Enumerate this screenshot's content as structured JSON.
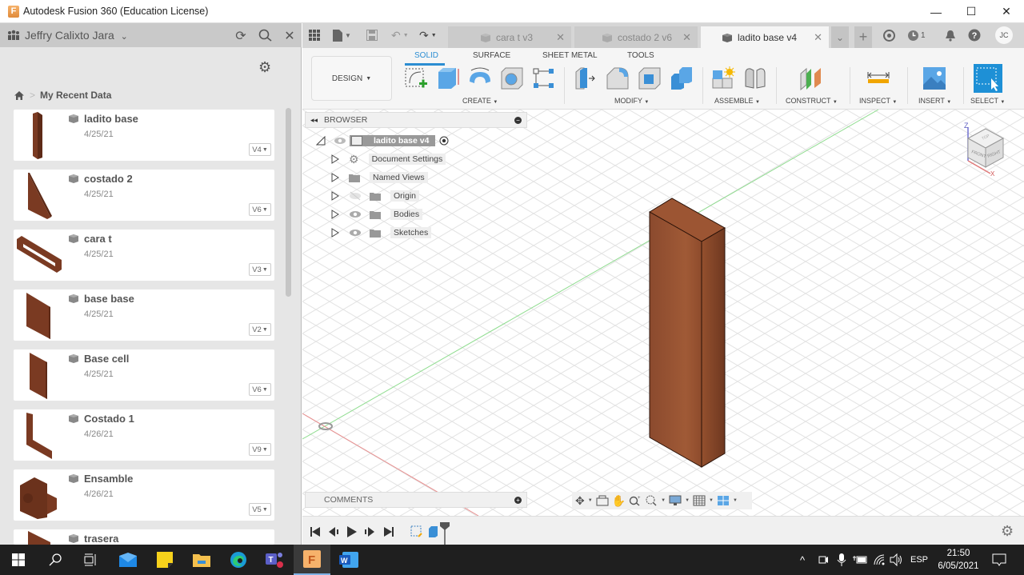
{
  "window": {
    "title": "Autodesk Fusion 360 (Education License)",
    "app_logo_letter": "F",
    "minimize": "—",
    "maximize": "☐",
    "close": "✕"
  },
  "data_panel": {
    "user_name": "Jeffry Calixto Jara",
    "breadcrumb": {
      "home_icon": "home-icon",
      "separator": ">",
      "current": "My Recent Data"
    },
    "items": [
      {
        "name": "ladito base",
        "date": "4/25/21",
        "version": "V4"
      },
      {
        "name": "costado 2",
        "date": "4/25/21",
        "version": "V6"
      },
      {
        "name": "cara t",
        "date": "4/25/21",
        "version": "V3"
      },
      {
        "name": "base base",
        "date": "4/25/21",
        "version": "V2"
      },
      {
        "name": "Base cell",
        "date": "4/25/21",
        "version": "V6"
      },
      {
        "name": "Costado 1",
        "date": "4/26/21",
        "version": "V9"
      },
      {
        "name": "Ensamble",
        "date": "4/26/21",
        "version": "V5"
      },
      {
        "name": "trasera",
        "date": "",
        "version": ""
      }
    ]
  },
  "doc_tabs": [
    {
      "label": "cara t v3",
      "active": false
    },
    {
      "label": "costado 2 v6",
      "active": false
    },
    {
      "label": "ladito base v4",
      "active": true
    }
  ],
  "header_right": {
    "jobs_count": "1",
    "user_initials": "JC"
  },
  "ribbon": {
    "workspace": "DESIGN",
    "tabs": [
      "SOLID",
      "SURFACE",
      "SHEET METAL",
      "TOOLS"
    ],
    "active_tab": "SOLID",
    "groups": [
      "CREATE",
      "MODIFY",
      "ASSEMBLE",
      "CONSTRUCT",
      "INSPECT",
      "INSERT",
      "SELECT"
    ]
  },
  "browser": {
    "title": "BROWSER",
    "root": "ladito base v4",
    "nodes": [
      "Document Settings",
      "Named Views",
      "Origin",
      "Bodies",
      "Sketches"
    ]
  },
  "comments": {
    "title": "COMMENTS"
  },
  "viewcube": {
    "top": "TOP",
    "front": "FRONT",
    "right": "RIGHT",
    "z_axis": "Z",
    "x_axis": "X"
  },
  "colors": {
    "accent": "#2b8dd2",
    "body": "#8b4a2e",
    "x_axis": "#e06666",
    "y_axis": "#6ccf6c"
  },
  "taskbar": {
    "language": "ESP",
    "time": "21:50",
    "date": "6/05/2021"
  }
}
